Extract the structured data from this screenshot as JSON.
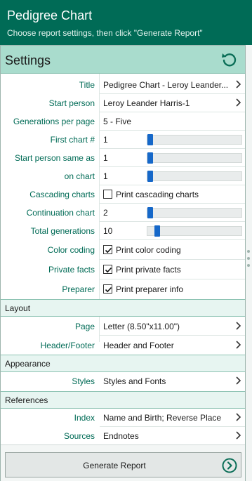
{
  "header": {
    "title": "Pedigree Chart",
    "subtitle": "Choose report settings, then click \"Generate Report\""
  },
  "settings": {
    "heading": "Settings",
    "reset_icon": "reset-icon",
    "title": {
      "label": "Title",
      "value": "Pedigree Chart - Leroy Leander..."
    },
    "start_person": {
      "label": "Start person",
      "value": "Leroy Leander Harris-1"
    },
    "generations": {
      "label": "Generations per page",
      "value": "5 - Five"
    },
    "first_chart": {
      "label": "First chart #",
      "value": "1",
      "level": 0.0
    },
    "start_same_as": {
      "label": "Start person same as",
      "value": "1",
      "level": 0.0
    },
    "on_chart": {
      "label": "on chart",
      "value": "1",
      "level": 0.0
    },
    "cascading": {
      "label": "Cascading charts",
      "option": "Print cascading charts",
      "checked": false
    },
    "continuation": {
      "label": "Continuation chart",
      "value": "2",
      "level": 0.0
    },
    "total_generations": {
      "label": "Total generations",
      "value": "10",
      "level": 0.08
    },
    "color_coding": {
      "label": "Color coding",
      "option": "Print color coding",
      "checked": true
    },
    "private_facts": {
      "label": "Private facts",
      "option": "Print private facts",
      "checked": true
    },
    "preparer": {
      "label": "Preparer",
      "option": "Print preparer info",
      "checked": true
    }
  },
  "layout": {
    "heading": "Layout",
    "page": {
      "label": "Page",
      "value": "Letter (8.50\"x11.00\")"
    },
    "header_footer": {
      "label": "Header/Footer",
      "value": "Header and Footer"
    }
  },
  "appearance": {
    "heading": "Appearance",
    "styles": {
      "label": "Styles",
      "value": "Styles and Fonts"
    }
  },
  "references": {
    "heading": "References",
    "index": {
      "label": "Index",
      "value": "Name and Birth; Reverse Place"
    },
    "sources": {
      "label": "Sources",
      "value": "Endnotes"
    }
  },
  "footer": {
    "generate_label": "Generate Report"
  },
  "colors": {
    "header_bg": "#006b56",
    "settings_bg": "#a9dccd",
    "label_color": "#006b56",
    "slider_thumb": "#1668c9"
  }
}
